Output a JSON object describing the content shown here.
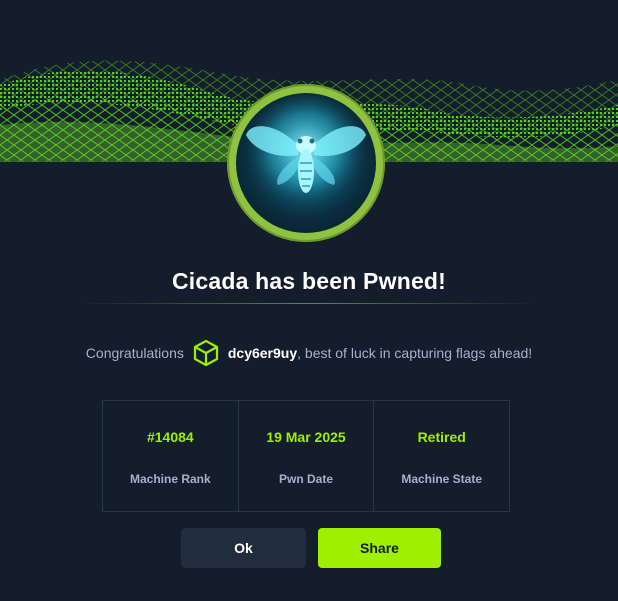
{
  "title": "Cicada has been Pwned!",
  "congrats": {
    "prefix": "Congratulations",
    "username": "dcy6er9uy",
    "suffix": ", best of luck in capturing flags ahead!"
  },
  "stats": [
    {
      "value": "#14084",
      "label": "Machine Rank"
    },
    {
      "value": "19 Mar 2025",
      "label": "Pwn Date"
    },
    {
      "value": "Retired",
      "label": "Machine State"
    }
  ],
  "buttons": {
    "ok": "Ok",
    "share": "Share"
  },
  "colors": {
    "background": "#141d2b",
    "accent": "#9fef00",
    "muted_text": "#a4b1cd",
    "ok_button": "#212c3d"
  },
  "icons": {
    "avatar": "cicada-icon",
    "user": "cube-icon"
  }
}
